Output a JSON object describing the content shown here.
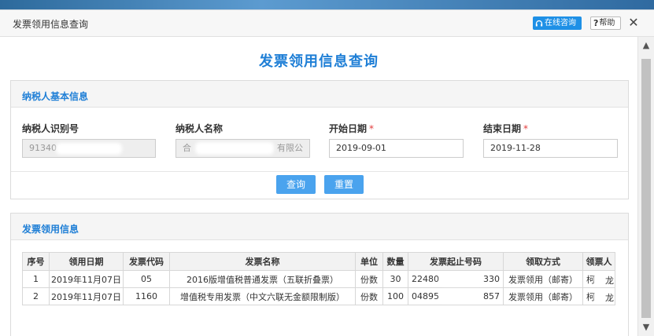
{
  "window": {
    "title": "发票领用信息查询",
    "online_label": "在线咨询",
    "help_label": "帮助",
    "help_q": "?",
    "close_glyph": "✕"
  },
  "page_title": "发票领用信息查询",
  "basic_info": {
    "heading": "纳税人基本信息",
    "fields": {
      "taxpayer_id": {
        "label": "纳税人识别号",
        "value": "91340"
      },
      "taxpayer_name": {
        "label": "纳税人名称",
        "value": "合",
        "value_tail": "有限公"
      },
      "start_date": {
        "label": "开始日期",
        "required": "*",
        "value": "2019-09-01"
      },
      "end_date": {
        "label": "结束日期",
        "required": "*",
        "value": "2019-11-28"
      }
    },
    "query_label": "查询",
    "reset_label": "重置"
  },
  "usage_info": {
    "heading": "发票领用信息",
    "columns": [
      "序号",
      "领用日期",
      "发票代码",
      "发票名称",
      "单位",
      "数量",
      "发票起止号码",
      "领取方式",
      "领票人"
    ],
    "rows": [
      {
        "no": "1",
        "date": "2019年11月07日",
        "code": "05",
        "name": "2016版增值税普通发票（五联折叠票）",
        "unit": "份数",
        "qty": "30",
        "range_start": "22480",
        "range_end": "330",
        "method": "发票领用（邮寄）",
        "receiver": "柯",
        "receiver_tail": "龙"
      },
      {
        "no": "2",
        "date": "2019年11月07日",
        "code": "1160",
        "name": "增值税专用发票（中文六联无金额限制版）",
        "unit": "份数",
        "qty": "100",
        "range_start": "04895",
        "range_end": "857",
        "method": "发票领用（邮寄）",
        "receiver": "柯",
        "receiver_tail": "龙"
      }
    ]
  },
  "colors": {
    "accent": "#1f7fd6",
    "button": "#4aa3ee",
    "online_button": "#1e90e6",
    "required": "#e23c3c"
  },
  "icons": {
    "online": "headset-icon",
    "scroll_up": "chevron-up-icon",
    "scroll_down": "chevron-down-icon"
  }
}
